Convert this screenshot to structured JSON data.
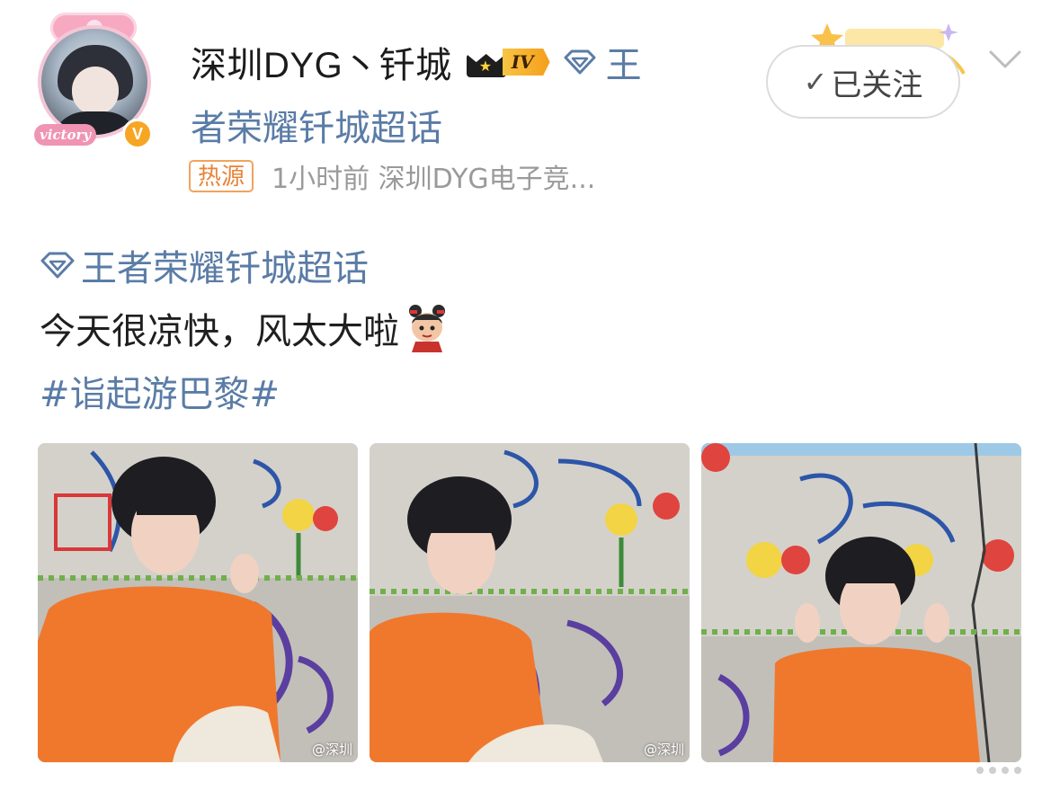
{
  "post": {
    "author": {
      "name": "深圳DYG丶钎城",
      "avatar_tag": "victory",
      "vip_level": "IV",
      "verified_mark": "V"
    },
    "topic_inline_part1": "王",
    "topic_inline_part2": "者荣耀钎城超话",
    "meta": {
      "hot_badge": "热源",
      "time_and_source": "1小时前   深圳DYG电子竞..."
    },
    "follow_button": {
      "check": "✓",
      "label": "已关注"
    },
    "body": {
      "topic": "王者荣耀钎城超话",
      "text": "今天很凉快，风太大啦",
      "hashtag": "#诣起游巴黎#"
    },
    "images": [
      {
        "watermark": "@深圳"
      },
      {
        "watermark": "@深圳"
      },
      {
        "watermark": ""
      }
    ]
  },
  "colors": {
    "link_blue": "#5a7ca6",
    "hot_orange": "#e8843a",
    "meta_gray": "#9a9a9a",
    "shirt_orange": "#f0782d"
  },
  "icons": {
    "topic": "diamond-gem-icon",
    "follow_check": "check-icon",
    "menu": "chevron-down-icon",
    "verify": "verified-v-icon",
    "vip": "crown-icon"
  }
}
